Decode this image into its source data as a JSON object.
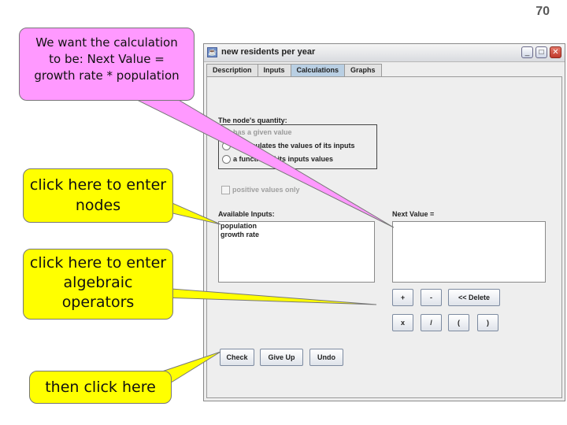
{
  "page_number": "70",
  "window": {
    "title": "new residents per year",
    "min_glyph": "_",
    "max_glyph": "□",
    "close_glyph": "✕"
  },
  "tabs": [
    "Description",
    "Inputs",
    "Calculations",
    "Graphs"
  ],
  "active_tab": "Calculations",
  "quantity": {
    "label": "The node's quantity:",
    "options": [
      {
        "label": "has a given value",
        "state": "disabled"
      },
      {
        "label": "accumulates the values of its inputs",
        "state": "enabled"
      },
      {
        "label": "a function of its inputs values",
        "state": "enabled"
      }
    ],
    "positive_only": "positive values only"
  },
  "available_inputs": {
    "label": "Available Inputs:",
    "items": [
      "population",
      "growth rate"
    ]
  },
  "next_value": {
    "label": "Next Value =",
    "value": ""
  },
  "operators": {
    "plus": "+",
    "minus": "-",
    "delete": "<< Delete",
    "times": "x",
    "divide": "/",
    "open_paren": "(",
    "close_paren": ")"
  },
  "actions": {
    "check": "Check",
    "give_up": "Give Up",
    "undo": "Undo"
  },
  "callouts": {
    "calculation_line1": "We want the calculation",
    "calculation_line2": "to be: Next Value =",
    "calculation_line3": "growth rate * population",
    "nodes_line1": "click here to enter",
    "nodes_line2": "nodes",
    "operators_line1": "click here to enter",
    "operators_line2": "algebraic",
    "operators_line3": "operators",
    "then": "then click here"
  },
  "colors": {
    "callout_yellow": "#ffff00",
    "callout_pink": "#ff99ff",
    "active_tab": "#b9cfe3"
  }
}
